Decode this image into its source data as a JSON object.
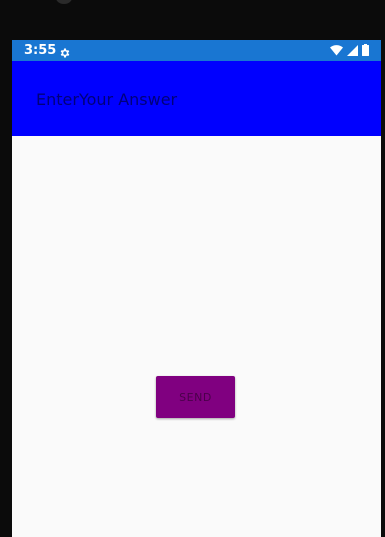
{
  "status_bar": {
    "time": "3:55",
    "background": "#1976d2",
    "icons": [
      "gear-icon",
      "wifi-icon",
      "cell-signal-icon",
      "battery-icon"
    ]
  },
  "app_bar": {
    "title": "EnterYour Answer",
    "background": "#0000ff",
    "title_color": "#00007a"
  },
  "content": {
    "background": "#fafafa",
    "send_button": {
      "label": "SEND",
      "background": "#800080"
    }
  }
}
